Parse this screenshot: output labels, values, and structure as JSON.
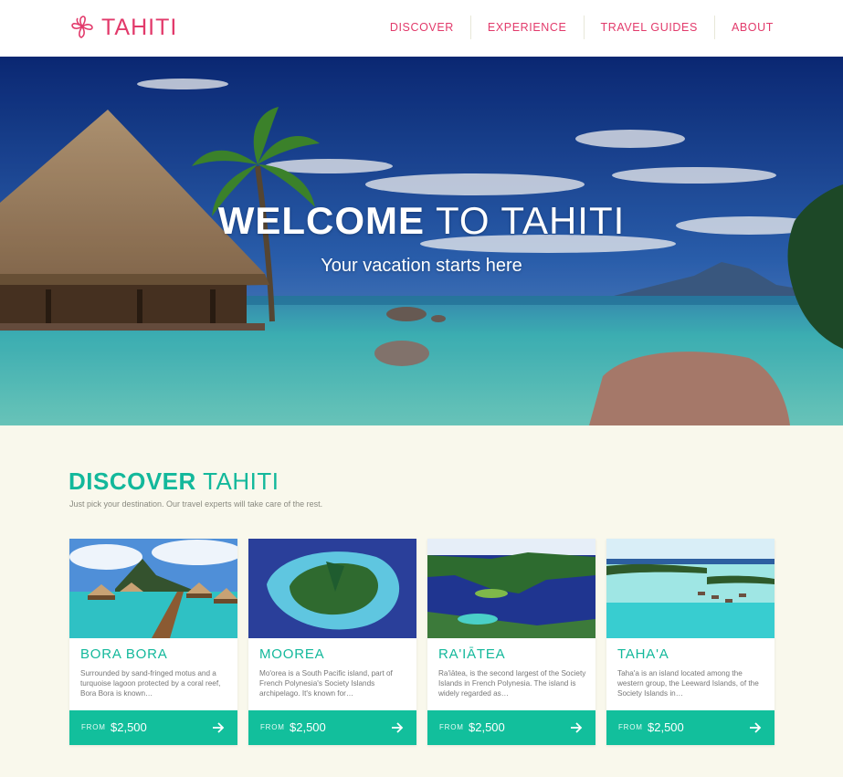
{
  "brand": {
    "name": "TAHITI",
    "logo_icon": "plumeria-flower-icon",
    "color": "#e23a6b"
  },
  "nav": [
    {
      "label": "DISCOVER"
    },
    {
      "label": "EXPERIENCE"
    },
    {
      "label": "TRAVEL GUIDES"
    },
    {
      "label": "ABOUT"
    }
  ],
  "hero": {
    "title_bold": "WELCOME",
    "title_light": "TO TAHITI",
    "subtitle": "Your vacation starts here"
  },
  "discover": {
    "title_bold": "DISCOVER",
    "title_light": "TAHITI",
    "subtitle": "Just pick your destination. Our travel experts will take care of the rest.",
    "accent": "#13b89b"
  },
  "cards": [
    {
      "title": "BORA BORA",
      "description": "Surrounded by sand-fringed motus and a turquoise lagoon protected by a coral reef, Bora Bora is known…",
      "from_label": "FROM",
      "price": "$2,500",
      "arrow_icon": "arrow-right-icon"
    },
    {
      "title": "MOOREA",
      "description": "Mo'orea is a South Pacific island, part of French Polynesia's Society Islands archipelago. It's known for…",
      "from_label": "FROM",
      "price": "$2,500",
      "arrow_icon": "arrow-right-icon"
    },
    {
      "title": "RA'IĀTEA",
      "description": "Ra'iātea, is the second largest of the Society Islands in French Polynesia. The island is widely regarded as…",
      "from_label": "FROM",
      "price": "$2,500",
      "arrow_icon": "arrow-right-icon"
    },
    {
      "title": "TAHA'A",
      "description": "Taha'a is an island located among the western group, the Leeward Islands, of the Society Islands in…",
      "from_label": "FROM",
      "price": "$2,500",
      "arrow_icon": "arrow-right-icon"
    }
  ]
}
